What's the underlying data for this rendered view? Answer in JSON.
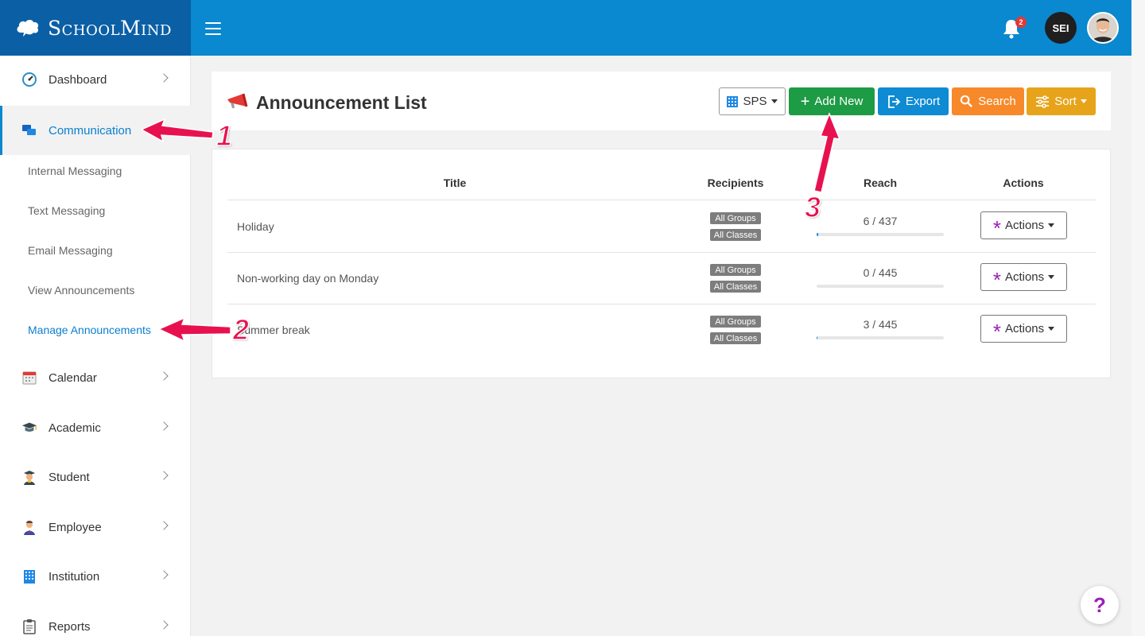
{
  "brand": {
    "name": "SchoolMind"
  },
  "topbar": {
    "notification_count": "2",
    "user_initials": "SEI"
  },
  "sidebar": {
    "items": [
      {
        "label": "Dashboard",
        "icon": "dashboard-gauge-icon"
      },
      {
        "label": "Communication",
        "icon": "chat-bubbles-icon"
      },
      {
        "label": "Calendar",
        "icon": "calendar-icon"
      },
      {
        "label": "Academic",
        "icon": "graduation-cap-icon"
      },
      {
        "label": "Student",
        "icon": "student-icon"
      },
      {
        "label": "Employee",
        "icon": "employee-icon"
      },
      {
        "label": "Institution",
        "icon": "building-icon"
      },
      {
        "label": "Reports",
        "icon": "clipboard-icon"
      }
    ],
    "communication_sub": [
      "Internal Messaging",
      "Text Messaging",
      "Email Messaging",
      "View Announcements",
      "Manage Announcements"
    ]
  },
  "page": {
    "title": "Announcement List",
    "buttons": {
      "sps": "SPS",
      "add": "Add New",
      "export": "Export",
      "search": "Search",
      "sort": "Sort"
    }
  },
  "table": {
    "headers": [
      "Title",
      "Recipients",
      "Reach",
      "Actions"
    ],
    "rows": [
      {
        "title": "Holiday",
        "recipients": [
          "All Groups",
          "All Classes"
        ],
        "reach": "6 / 437",
        "reach_fraction": 0.014,
        "action": "Actions"
      },
      {
        "title": "Non-working day on Monday",
        "recipients": [
          "All Groups",
          "All Classes"
        ],
        "reach": "0 / 445",
        "reach_fraction": 0,
        "action": "Actions"
      },
      {
        "title": "Summer break",
        "recipients": [
          "All Groups",
          "All Classes"
        ],
        "reach": "3 / 445",
        "reach_fraction": 0.007,
        "action": "Actions"
      }
    ]
  },
  "annotations": [
    "1",
    "2",
    "3"
  ],
  "help": {
    "label": "?"
  },
  "colors": {
    "topbar": "#0a88d0",
    "brand_bg": "#0b5fa5",
    "add": "#1e9b45",
    "export": "#0e8bd3",
    "search": "#f7892b",
    "sort": "#e7a41b",
    "annotation": "#e8114f",
    "accent_purple": "#9b1fb5"
  }
}
